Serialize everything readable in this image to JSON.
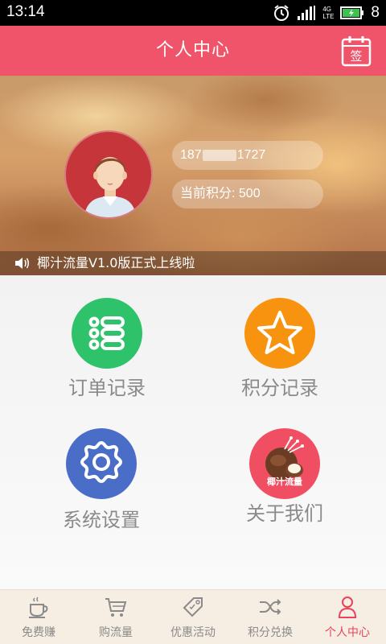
{
  "status_bar": {
    "time": "13:14",
    "network": "4G",
    "network_sub": "LTE",
    "battery": "8"
  },
  "header": {
    "title": "个人中心",
    "sign_label": "签"
  },
  "profile": {
    "phone_prefix": "187",
    "phone_suffix": "1727",
    "points_text": "当前积分: 500"
  },
  "notice": {
    "text": "椰汁流量V1.0版正式上线啦"
  },
  "menu": [
    {
      "label": "订单记录",
      "icon": "list-icon",
      "color": "#2ec36b"
    },
    {
      "label": "积分记录",
      "icon": "star-icon",
      "color": "#f7930e"
    },
    {
      "label": "系统设置",
      "icon": "gear-icon",
      "color": "#4a6ec8"
    },
    {
      "label": "关于我们",
      "icon": "coconut-logo-icon",
      "color": "#f04e63",
      "logo_text": "椰汁流量"
    }
  ],
  "tabs": [
    {
      "label": "免费赚",
      "icon": "coffee-cup-icon",
      "active": false
    },
    {
      "label": "购流量",
      "icon": "cart-icon",
      "active": false
    },
    {
      "label": "优惠活动",
      "icon": "tag-icon",
      "active": false
    },
    {
      "label": "积分兑换",
      "icon": "shuffle-icon",
      "active": false
    },
    {
      "label": "个人中心",
      "icon": "person-icon",
      "active": true
    }
  ],
  "colors": {
    "accent": "#f0546a",
    "tab_active": "#e9445a",
    "tab_bg": "#f6ede3"
  }
}
